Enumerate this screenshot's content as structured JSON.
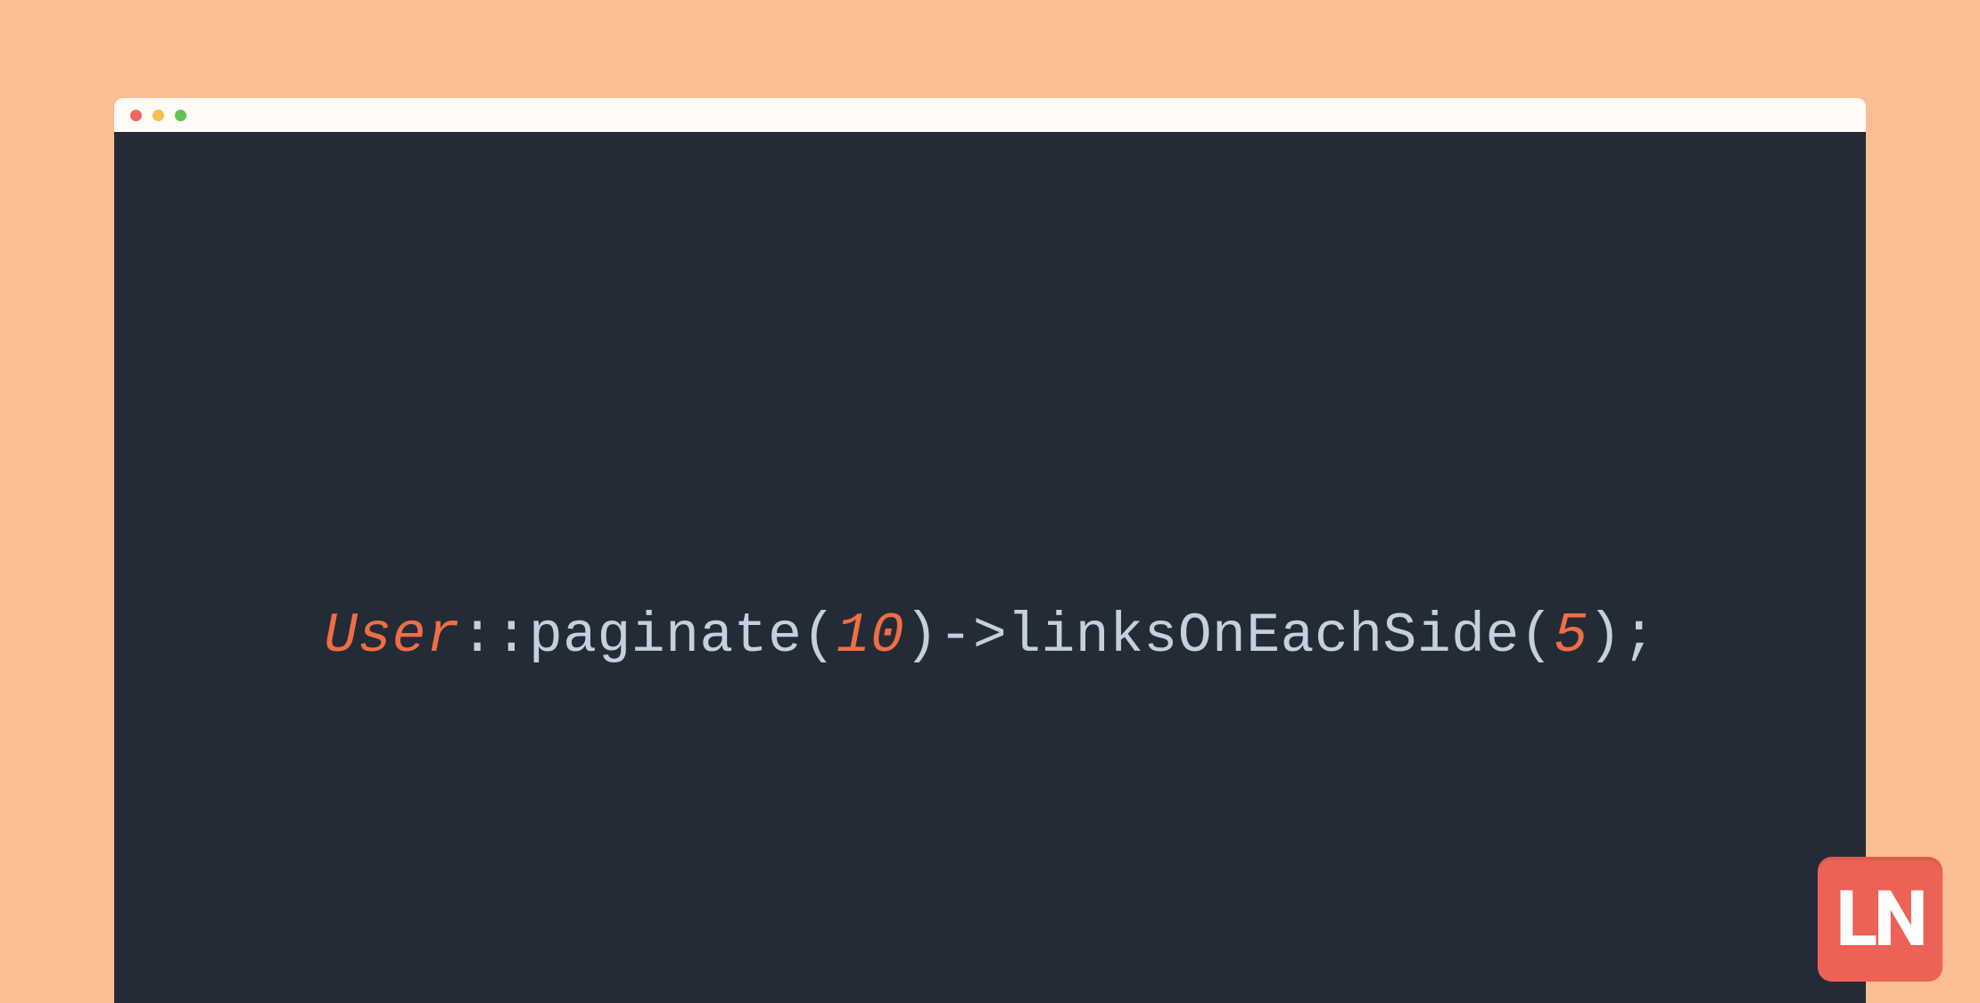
{
  "code": {
    "tokens": {
      "class": "User",
      "scope": "::",
      "method1": "paginate",
      "paren_open1": "(",
      "arg1": "10",
      "paren_close1": ")",
      "arrow": "->",
      "method2": "linksOnEachSide",
      "paren_open2": "(",
      "arg2": "5",
      "paren_close2": ")",
      "semi": ";"
    }
  },
  "logo": {
    "text": "LN"
  },
  "colors": {
    "page_bg": "#fbbd93",
    "titlebar_bg": "#fffbf7",
    "editor_bg": "#232b36",
    "token_default": "#c4d1dd",
    "token_accent": "#ef6e46",
    "logo_bg": "#ec6256",
    "logo_fg": "#ffffff",
    "traffic_red": "#ec695e",
    "traffic_yellow": "#f5be4f",
    "traffic_green": "#61c454"
  }
}
